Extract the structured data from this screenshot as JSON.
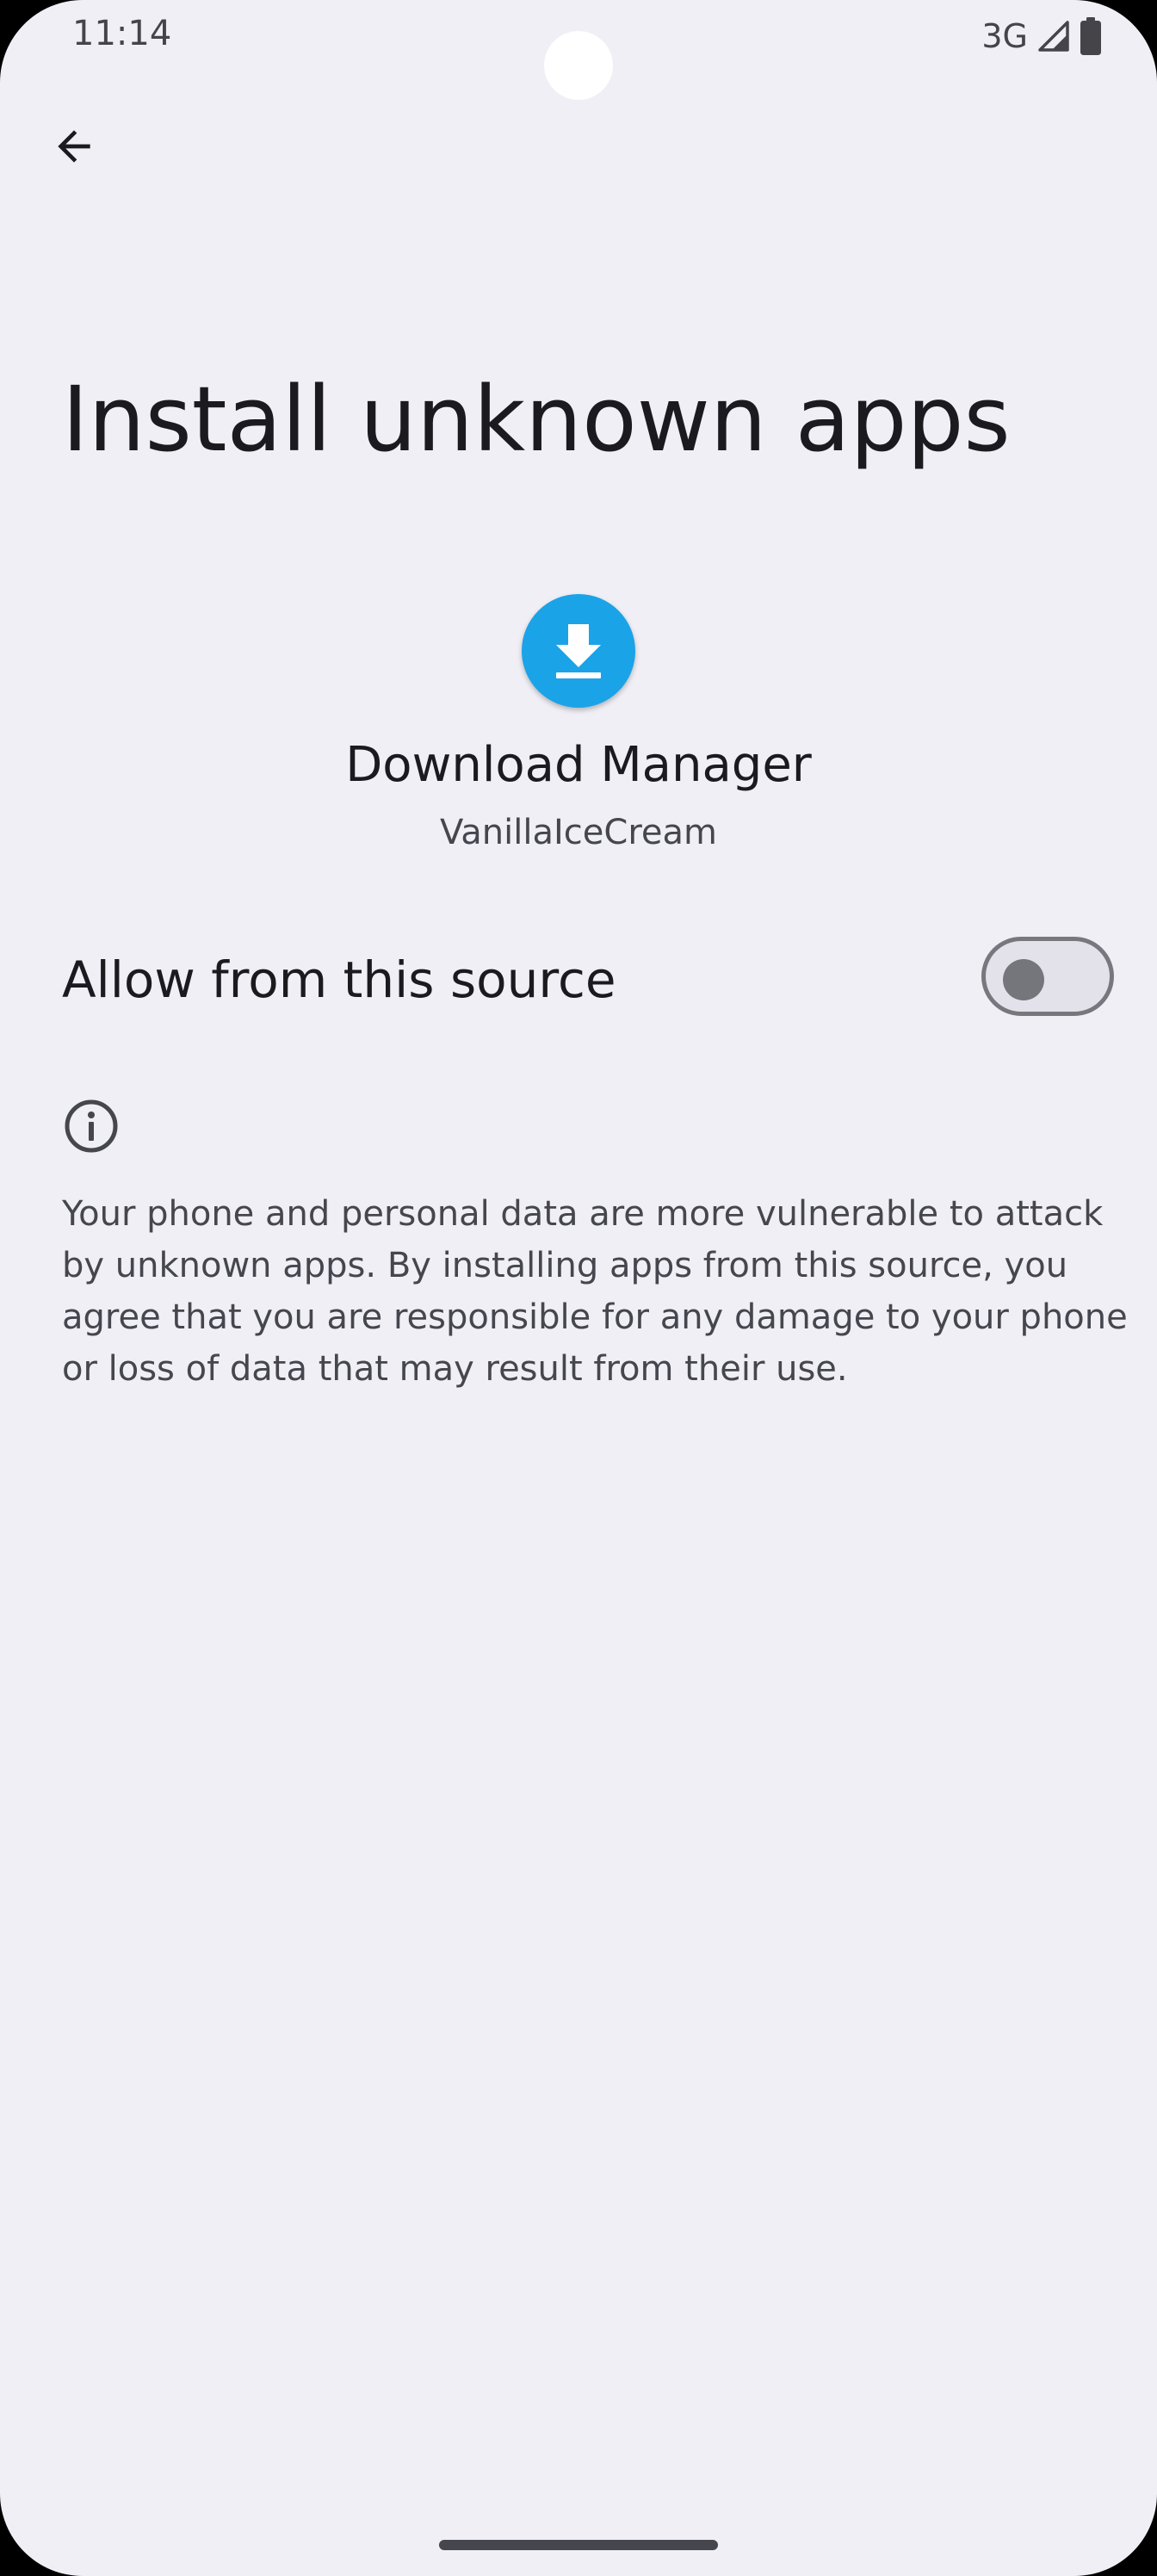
{
  "status_bar": {
    "time": "11:14",
    "network": "3G",
    "icons": [
      "signal-icon",
      "battery-icon"
    ]
  },
  "toolbar": {
    "back_icon": "arrow-back-icon"
  },
  "page": {
    "title": "Install unknown apps"
  },
  "app": {
    "icon": "download-icon",
    "icon_color": "#1ba3e8",
    "name": "Download Manager",
    "version": "VanillaIceCream"
  },
  "allow_setting": {
    "label": "Allow from this source",
    "enabled": false
  },
  "info": {
    "icon": "info-icon",
    "text": "Your phone and personal data are more vulnerable to attack by unknown apps. By installing apps from this source, you agree that you are responsible for any damage to your phone or loss of data that may result from their use."
  },
  "colors": {
    "background": "#f0eff5",
    "text_primary": "#1b1b1f",
    "text_secondary": "#46464f"
  }
}
